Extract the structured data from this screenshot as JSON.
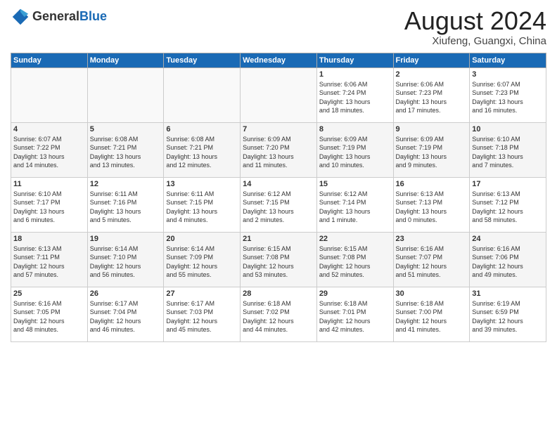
{
  "header": {
    "logo_general": "General",
    "logo_blue": "Blue",
    "month_title": "August 2024",
    "location": "Xiufeng, Guangxi, China"
  },
  "days_of_week": [
    "Sunday",
    "Monday",
    "Tuesday",
    "Wednesday",
    "Thursday",
    "Friday",
    "Saturday"
  ],
  "weeks": [
    [
      {
        "num": "",
        "info": ""
      },
      {
        "num": "",
        "info": ""
      },
      {
        "num": "",
        "info": ""
      },
      {
        "num": "",
        "info": ""
      },
      {
        "num": "1",
        "info": "Sunrise: 6:06 AM\nSunset: 7:24 PM\nDaylight: 13 hours\nand 18 minutes."
      },
      {
        "num": "2",
        "info": "Sunrise: 6:06 AM\nSunset: 7:23 PM\nDaylight: 13 hours\nand 17 minutes."
      },
      {
        "num": "3",
        "info": "Sunrise: 6:07 AM\nSunset: 7:23 PM\nDaylight: 13 hours\nand 16 minutes."
      }
    ],
    [
      {
        "num": "4",
        "info": "Sunrise: 6:07 AM\nSunset: 7:22 PM\nDaylight: 13 hours\nand 14 minutes."
      },
      {
        "num": "5",
        "info": "Sunrise: 6:08 AM\nSunset: 7:21 PM\nDaylight: 13 hours\nand 13 minutes."
      },
      {
        "num": "6",
        "info": "Sunrise: 6:08 AM\nSunset: 7:21 PM\nDaylight: 13 hours\nand 12 minutes."
      },
      {
        "num": "7",
        "info": "Sunrise: 6:09 AM\nSunset: 7:20 PM\nDaylight: 13 hours\nand 11 minutes."
      },
      {
        "num": "8",
        "info": "Sunrise: 6:09 AM\nSunset: 7:19 PM\nDaylight: 13 hours\nand 10 minutes."
      },
      {
        "num": "9",
        "info": "Sunrise: 6:09 AM\nSunset: 7:19 PM\nDaylight: 13 hours\nand 9 minutes."
      },
      {
        "num": "10",
        "info": "Sunrise: 6:10 AM\nSunset: 7:18 PM\nDaylight: 13 hours\nand 7 minutes."
      }
    ],
    [
      {
        "num": "11",
        "info": "Sunrise: 6:10 AM\nSunset: 7:17 PM\nDaylight: 13 hours\nand 6 minutes."
      },
      {
        "num": "12",
        "info": "Sunrise: 6:11 AM\nSunset: 7:16 PM\nDaylight: 13 hours\nand 5 minutes."
      },
      {
        "num": "13",
        "info": "Sunrise: 6:11 AM\nSunset: 7:15 PM\nDaylight: 13 hours\nand 4 minutes."
      },
      {
        "num": "14",
        "info": "Sunrise: 6:12 AM\nSunset: 7:15 PM\nDaylight: 13 hours\nand 2 minutes."
      },
      {
        "num": "15",
        "info": "Sunrise: 6:12 AM\nSunset: 7:14 PM\nDaylight: 13 hours\nand 1 minute."
      },
      {
        "num": "16",
        "info": "Sunrise: 6:13 AM\nSunset: 7:13 PM\nDaylight: 13 hours\nand 0 minutes."
      },
      {
        "num": "17",
        "info": "Sunrise: 6:13 AM\nSunset: 7:12 PM\nDaylight: 12 hours\nand 58 minutes."
      }
    ],
    [
      {
        "num": "18",
        "info": "Sunrise: 6:13 AM\nSunset: 7:11 PM\nDaylight: 12 hours\nand 57 minutes."
      },
      {
        "num": "19",
        "info": "Sunrise: 6:14 AM\nSunset: 7:10 PM\nDaylight: 12 hours\nand 56 minutes."
      },
      {
        "num": "20",
        "info": "Sunrise: 6:14 AM\nSunset: 7:09 PM\nDaylight: 12 hours\nand 55 minutes."
      },
      {
        "num": "21",
        "info": "Sunrise: 6:15 AM\nSunset: 7:08 PM\nDaylight: 12 hours\nand 53 minutes."
      },
      {
        "num": "22",
        "info": "Sunrise: 6:15 AM\nSunset: 7:08 PM\nDaylight: 12 hours\nand 52 minutes."
      },
      {
        "num": "23",
        "info": "Sunrise: 6:16 AM\nSunset: 7:07 PM\nDaylight: 12 hours\nand 51 minutes."
      },
      {
        "num": "24",
        "info": "Sunrise: 6:16 AM\nSunset: 7:06 PM\nDaylight: 12 hours\nand 49 minutes."
      }
    ],
    [
      {
        "num": "25",
        "info": "Sunrise: 6:16 AM\nSunset: 7:05 PM\nDaylight: 12 hours\nand 48 minutes."
      },
      {
        "num": "26",
        "info": "Sunrise: 6:17 AM\nSunset: 7:04 PM\nDaylight: 12 hours\nand 46 minutes."
      },
      {
        "num": "27",
        "info": "Sunrise: 6:17 AM\nSunset: 7:03 PM\nDaylight: 12 hours\nand 45 minutes."
      },
      {
        "num": "28",
        "info": "Sunrise: 6:18 AM\nSunset: 7:02 PM\nDaylight: 12 hours\nand 44 minutes."
      },
      {
        "num": "29",
        "info": "Sunrise: 6:18 AM\nSunset: 7:01 PM\nDaylight: 12 hours\nand 42 minutes."
      },
      {
        "num": "30",
        "info": "Sunrise: 6:18 AM\nSunset: 7:00 PM\nDaylight: 12 hours\nand 41 minutes."
      },
      {
        "num": "31",
        "info": "Sunrise: 6:19 AM\nSunset: 6:59 PM\nDaylight: 12 hours\nand 39 minutes."
      }
    ]
  ]
}
